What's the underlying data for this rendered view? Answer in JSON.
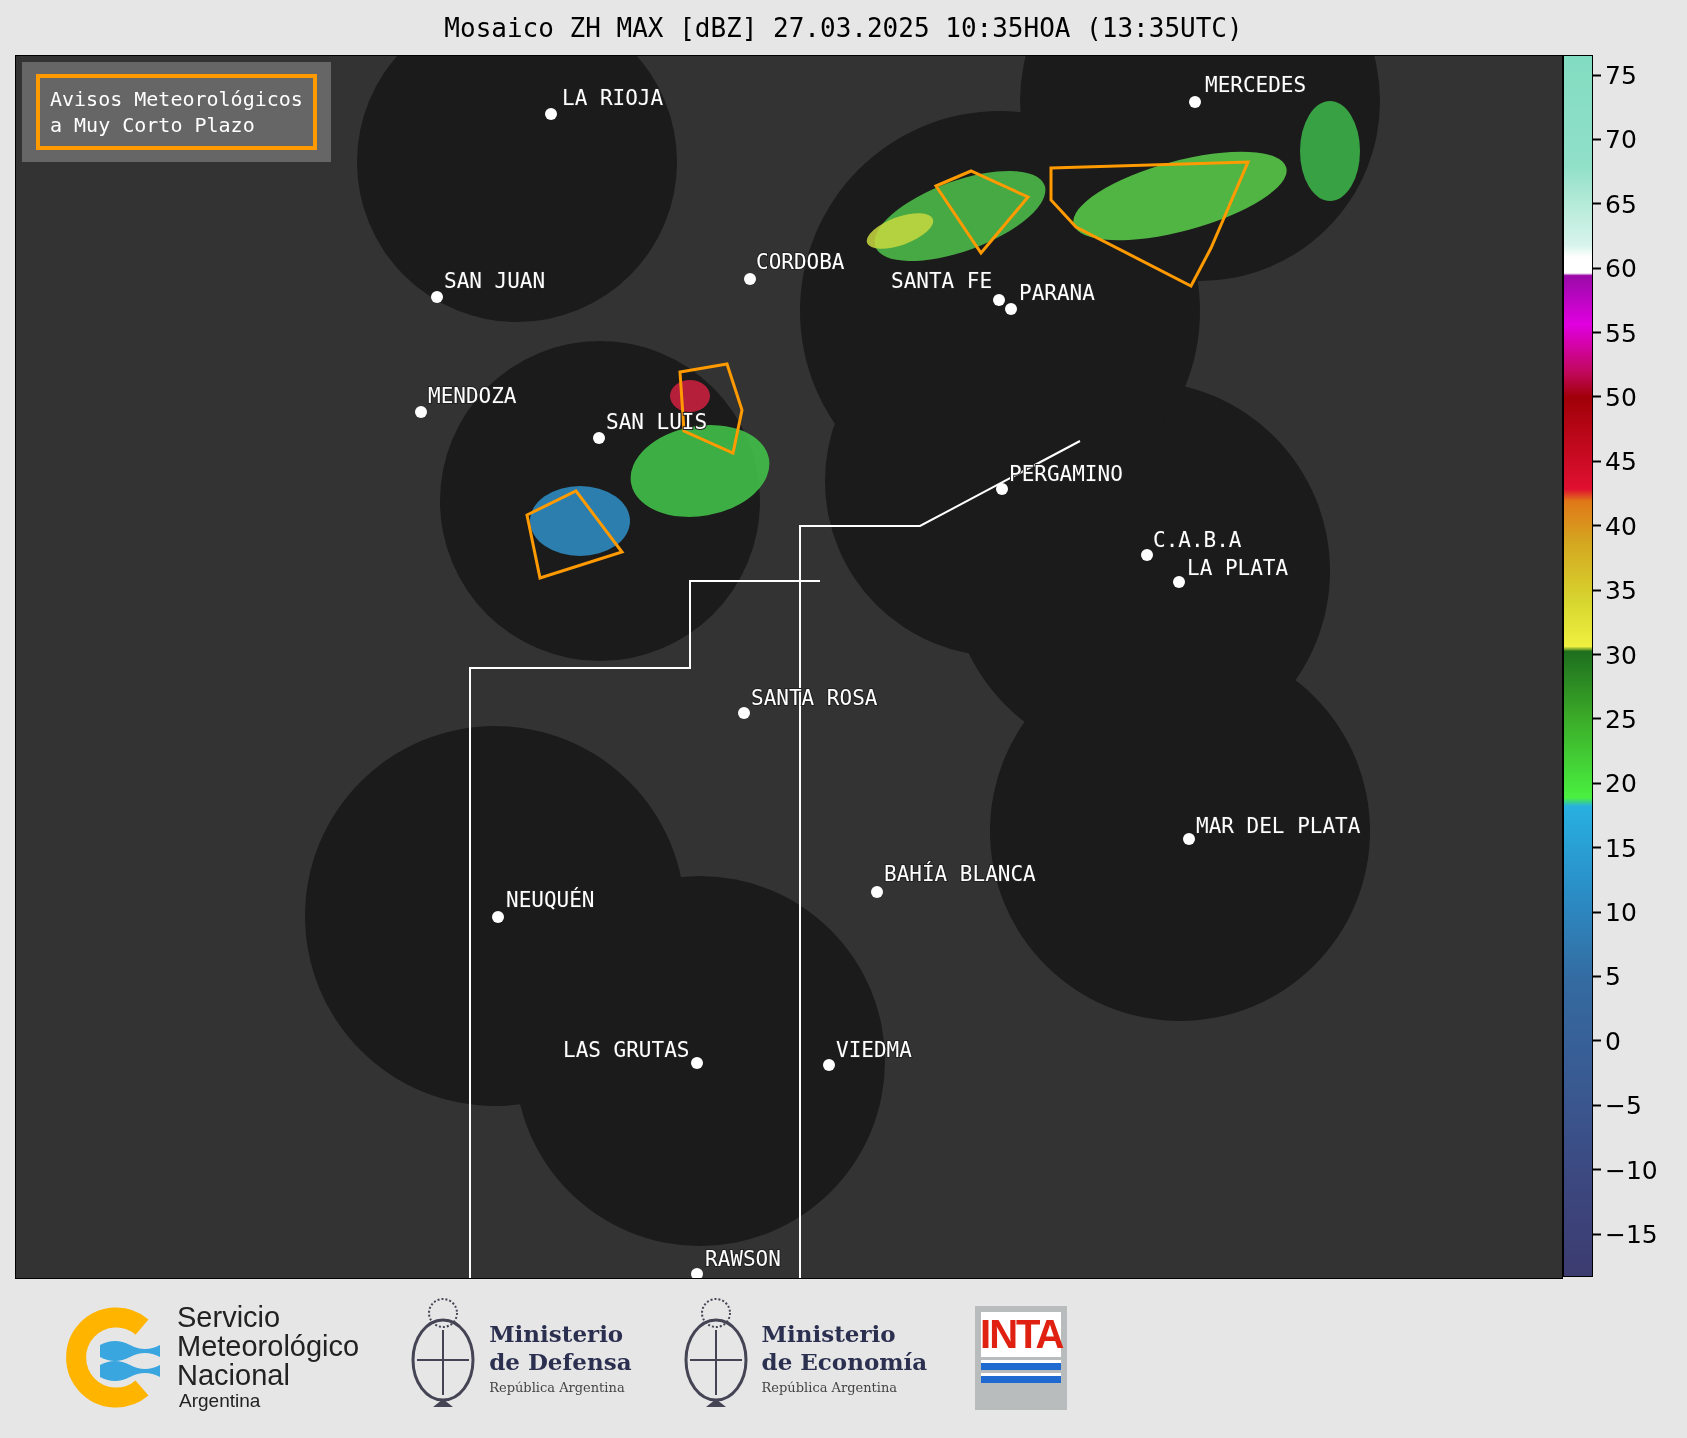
{
  "title": "Mosaico ZH MAX [dBZ] 27.03.2025 10:35HOA (13:35UTC)",
  "warning_legend": {
    "lines": [
      "Avisos Meteorológicos",
      "a Muy Corto Plazo"
    ]
  },
  "cities": [
    "LA RIOJA",
    "CORDOBA",
    "SAN JUAN",
    "SANTA FE",
    "PARANA",
    "MENDOZA",
    "SAN LUIS",
    "MERCEDES",
    "PERGAMINO",
    "C.A.B.A",
    "LA PLATA",
    "SANTA ROSA",
    "MAR DEL PLATA",
    "BAHÍA BLANCA",
    "NEUQUÉN",
    "LAS GRUTAS",
    "VIEDMA",
    "RAWSON"
  ],
  "colorbar": {
    "ticks": [
      "75",
      "70",
      "65",
      "60",
      "55",
      "50",
      "45",
      "40",
      "35",
      "30",
      "25",
      "20",
      "15",
      "10",
      "5",
      "0",
      "−5",
      "−10",
      "−15"
    ]
  },
  "logos": [
    {
      "kind": "smn",
      "lines": [
        "Servicio",
        "Meteorológico",
        "Nacional",
        "Argentina"
      ]
    },
    {
      "kind": "ministry",
      "lines": [
        "Ministerio",
        "de Defensa",
        "República Argentina"
      ]
    },
    {
      "kind": "ministry",
      "lines": [
        "Ministerio",
        "de Economía",
        "República Argentina"
      ]
    },
    {
      "kind": "inta",
      "lines": [
        "INTA"
      ]
    }
  ]
}
